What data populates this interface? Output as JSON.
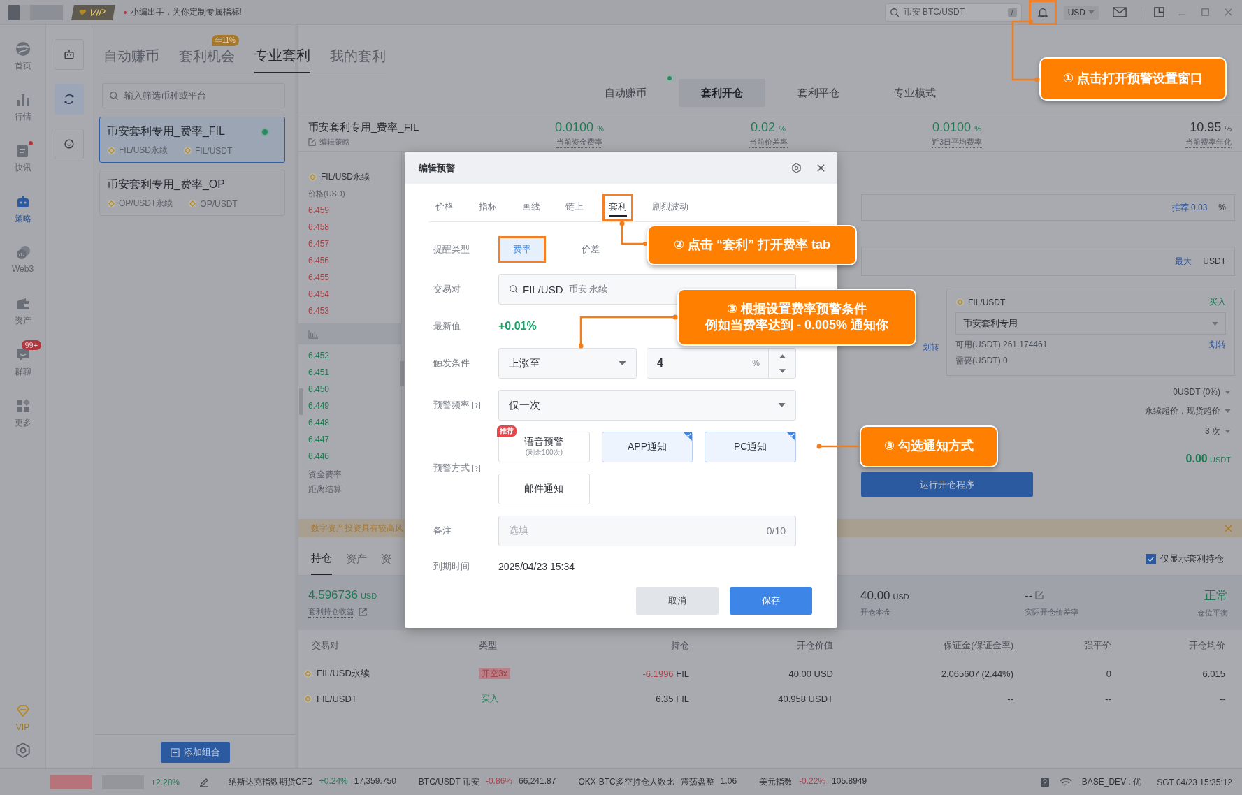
{
  "top_bar": {
    "vip_badge": "VIP",
    "notice": "小编出手，为你定制专属指标!",
    "search_placeholder": "币安 BTC/USDT",
    "search_shortcut": "/",
    "bell_highlighted": true,
    "currency": "USD"
  },
  "nav_rail": {
    "items": [
      {
        "label": "首页",
        "kind": "home",
        "selected": false,
        "dot": false
      },
      {
        "label": "行情",
        "kind": "market",
        "selected": false,
        "dot": false
      },
      {
        "label": "快讯",
        "kind": "news",
        "selected": false,
        "dot": true
      },
      {
        "label": "策略",
        "kind": "strategy",
        "selected": true,
        "dot": false
      },
      {
        "label": "Web3",
        "kind": "web3",
        "selected": false,
        "dot": false
      },
      {
        "label": "资产",
        "kind": "assets",
        "selected": false,
        "dot": false
      },
      {
        "label": "群聊",
        "kind": "chat",
        "selected": false,
        "dot": false,
        "badge": "99+"
      },
      {
        "label": "更多",
        "kind": "more",
        "selected": false,
        "dot": false
      }
    ],
    "vip_label": "VIP"
  },
  "tool_rail": [
    {
      "kind": "robot",
      "selected": false
    },
    {
      "kind": "cycle",
      "selected": true
    },
    {
      "kind": "chat",
      "selected": false
    }
  ],
  "left_panel": {
    "tabs": [
      {
        "label": "自动赚币",
        "selected": false
      },
      {
        "label": "套利机会",
        "selected": false,
        "badge": "年11%"
      },
      {
        "label": "专业套利",
        "selected": true
      },
      {
        "label": "我的套利",
        "selected": false
      }
    ],
    "search": {
      "placeholder": "输入筛选币种或平台"
    },
    "strategies": [
      {
        "name": "币安套利专用_费率_FIL",
        "selected": true,
        "running": true,
        "pairs": [
          "FIL/USD永续",
          "FIL/USDT"
        ]
      },
      {
        "name": "币安套利专用_费率_OP",
        "selected": false,
        "running": false,
        "pairs": [
          "OP/USDT永续",
          "OP/USDT"
        ]
      }
    ],
    "add_button": "添加组合"
  },
  "sub_tabs": [
    {
      "label": "自动赚币",
      "selected": false,
      "dot": true
    },
    {
      "label": "套利开仓",
      "selected": true,
      "dot": false
    },
    {
      "label": "套利平仓",
      "selected": false,
      "dot": false
    },
    {
      "label": "专业模式",
      "selected": false,
      "dot": false
    }
  ],
  "strategy_header": {
    "name": "币安套利专用_费率_FIL",
    "edit_link": "编辑策略",
    "stats": [
      {
        "value": "0.0100",
        "unit": "%",
        "label": "当前资金费率",
        "positive": true
      },
      {
        "value": "0.02",
        "unit": "%",
        "label": "当前价差率",
        "positive": true
      },
      {
        "value": "0.0100",
        "unit": "%",
        "label": "近3日平均费率",
        "positive": true
      },
      {
        "value": "10.95",
        "unit": "%",
        "label": "当前费率年化",
        "positive": false
      }
    ]
  },
  "order_book": {
    "pair": "FIL/USD永续",
    "price_header": "价格(USD)",
    "asks": [
      "6.459",
      "6.458",
      "6.457",
      "6.456",
      "6.455",
      "6.454",
      "6.453"
    ],
    "bids": [
      "6.452",
      "6.451",
      "6.450",
      "6.449",
      "6.448",
      "6.447",
      "6.446"
    ],
    "funding_label": "资金费率",
    "settle_label": "距离结算"
  },
  "open_form": {
    "recommend": "推荐 0.03",
    "recommend_unit": "%",
    "max_link": "最大",
    "amount_unit": "USDT",
    "left_transfer": "划转",
    "spot": {
      "pair": "FIL/USDT",
      "side": "买入",
      "account": "币安套利专用",
      "available": "可用(USDT) 261.174461",
      "required": "需要(USDT) 0",
      "transfer": "划转"
    },
    "fee": "0USDT (0%)",
    "slippage": "永续超价，现货超价",
    "retries": "3 次",
    "total": "0.00",
    "total_unit": "USDT",
    "run_button": "运行开仓程序"
  },
  "warning_banner": {
    "text": "数字资产投资具有较高风"
  },
  "positions": {
    "tabs": [
      {
        "label": "持仓",
        "selected": true
      },
      {
        "label": "资产",
        "selected": false
      },
      {
        "label": "资",
        "selected": false
      }
    ],
    "only_arbitrage": {
      "label": "仅显示套利持仓",
      "checked": true
    },
    "summary": [
      {
        "value": "4.596736",
        "unit": "USD",
        "label": "套利持仓收益",
        "positive": true,
        "kind": "link"
      },
      {
        "value": "40.00",
        "unit": "USD",
        "label": "开仓本金",
        "positive": false,
        "kind": "plain"
      },
      {
        "value": "--",
        "label": "实际开仓价差率",
        "positive": false,
        "kind": "edit"
      },
      {
        "value": "正常",
        "label": "仓位平衡",
        "positive": true,
        "kind": "plain"
      }
    ],
    "columns": [
      "交易对",
      "类型",
      "持仓",
      "开仓价值",
      "保证金(保证金率)",
      "强平价",
      "开仓均价"
    ],
    "rows": [
      {
        "pair": "FIL/USD永续",
        "type": {
          "label": "开空3x",
          "kind": "short"
        },
        "amount": "-6.1996",
        "amount_unit": "FIL",
        "amount_negative": true,
        "value": "40.00 USD",
        "margin": "2.065607 (2.44%)",
        "liq_price": "0",
        "avg_price": "6.015"
      },
      {
        "pair": "FIL/USDT",
        "type": {
          "label": "买入",
          "kind": "long"
        },
        "amount": "6.35",
        "amount_unit": "FIL",
        "amount_negative": false,
        "value": "40.958 USDT",
        "margin": "--",
        "liq_price": "--",
        "avg_price": "--"
      }
    ]
  },
  "alert_dialog": {
    "title": "编辑预警",
    "tabs": [
      {
        "label": "价格",
        "selected": false,
        "highlighted": false
      },
      {
        "label": "指标",
        "selected": false,
        "highlighted": false
      },
      {
        "label": "画线",
        "selected": false,
        "highlighted": false
      },
      {
        "label": "链上",
        "selected": false,
        "highlighted": false
      },
      {
        "label": "套利",
        "selected": true,
        "highlighted": true
      },
      {
        "label": "剧烈波动",
        "selected": false,
        "highlighted": false
      }
    ],
    "remind_type": {
      "label": "提醒类型",
      "options": [
        {
          "label": "费率",
          "selected": true,
          "highlighted": true
        },
        {
          "label": "价差",
          "selected": false,
          "highlighted": false
        }
      ]
    },
    "pair": {
      "label": "交易对",
      "symbol": "FIL/USD",
      "exchange": "币安 永续"
    },
    "latest": {
      "label": "最新值",
      "value": "+0.01%"
    },
    "trigger": {
      "label": "触发条件",
      "condition": "上涨至",
      "value": "4",
      "unit": "%"
    },
    "frequency": {
      "label": "预警频率",
      "value": "仅一次"
    },
    "methods": {
      "label": "预警方式",
      "options": [
        {
          "label": "语音预警",
          "note": "(剩余100次)",
          "badge": "推荐",
          "checked": false
        },
        {
          "label": "APP通知",
          "checked": true
        },
        {
          "label": "PC通知",
          "checked": true
        },
        {
          "label": "邮件通知",
          "checked": false
        }
      ]
    },
    "note": {
      "label": "备注",
      "placeholder": "选填",
      "counter": "0/10"
    },
    "expiry": {
      "label": "到期时间",
      "value": "2025/04/23 15:34"
    },
    "buttons": {
      "cancel": "取消",
      "save": "保存"
    }
  },
  "callouts": [
    {
      "lines": [
        "① 点击打开预警设置窗口"
      ]
    },
    {
      "lines": [
        "② 点击 “套利” 打开费率 tab"
      ]
    },
    {
      "lines": [
        "③ 根据设置费率预警条件",
        "例如当费率达到 - 0.005% 通知你"
      ]
    },
    {
      "lines": [
        "③ 勾选通知方式"
      ]
    }
  ],
  "status_bar": {
    "change": "+2.28%",
    "tickers": [
      {
        "name": "纳斯达克指数期货CFD",
        "change": "+0.24%",
        "kind": "gain",
        "price": "17,359.750"
      },
      {
        "name": "BTC/USDT 币安",
        "change": "-0.86%",
        "kind": "loss",
        "price": "66,241.87"
      },
      {
        "name": "OKX-BTC多空持仓人数比",
        "change": "震荡盘整",
        "kind": "flat",
        "price": "1.06"
      },
      {
        "name": "美元指数",
        "change": "-0.22%",
        "kind": "loss",
        "price": "105.8949"
      }
    ],
    "network": "BASE_DEV : 优",
    "clock": "SGT 04/23 15:35:12"
  }
}
